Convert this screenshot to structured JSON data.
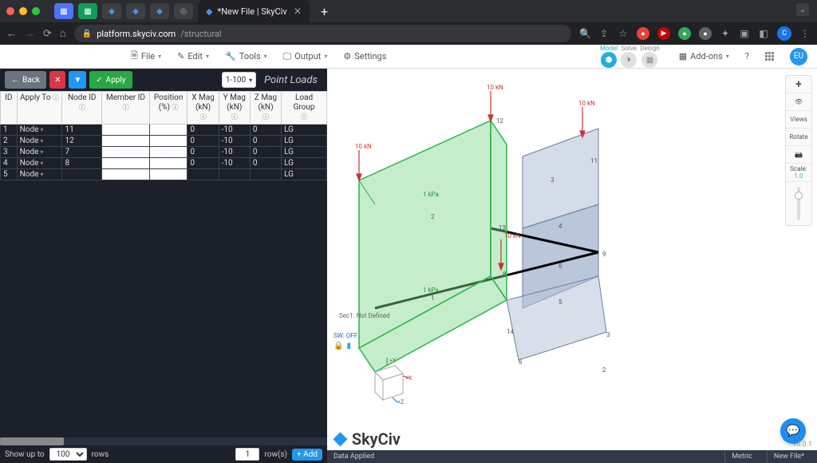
{
  "browser": {
    "tab_title": "*New File | SkyCiv",
    "url_domain": "platform.skyciv.com",
    "url_path": "/structural",
    "avatar": "C"
  },
  "toolbar": {
    "file": "File",
    "edit": "Edit",
    "tools": "Tools",
    "output": "Output",
    "settings": "Settings",
    "addons": "Add-ons",
    "wf_model": "Model",
    "wf_solve": "Solve",
    "wf_design": "Design",
    "eu": "EU"
  },
  "panel": {
    "back": "Back",
    "apply": "Apply",
    "range": "1-100",
    "title": "Point Loads",
    "headers": {
      "id": "ID",
      "apply": "Apply To",
      "node": "Node ID",
      "member": "Member ID",
      "pos": "Position (%)",
      "xmag": "X Mag (kN)",
      "ymag": "Y Mag (kN)",
      "zmag": "Z Mag (kN)",
      "lg": "Load Group"
    },
    "rows": [
      {
        "id": "1",
        "apply": "Node",
        "node": "11",
        "member": "",
        "pos": "",
        "x": "0",
        "y": "-10",
        "z": "0",
        "lg": "LG"
      },
      {
        "id": "2",
        "apply": "Node",
        "node": "12",
        "member": "",
        "pos": "",
        "x": "0",
        "y": "-10",
        "z": "0",
        "lg": "LG"
      },
      {
        "id": "3",
        "apply": "Node",
        "node": "7",
        "member": "",
        "pos": "",
        "x": "0",
        "y": "-10",
        "z": "0",
        "lg": "LG"
      },
      {
        "id": "4",
        "apply": "Node",
        "node": "8",
        "member": "",
        "pos": "",
        "x": "0",
        "y": "-10",
        "z": "0",
        "lg": "LG"
      },
      {
        "id": "5",
        "apply": "Node",
        "node": "",
        "member": "",
        "pos": "",
        "x": "",
        "y": "",
        "z": "",
        "lg": "LG"
      }
    ],
    "showup_label": "Show up to",
    "showup_val": "100",
    "rows_label": "rows",
    "rowcount": "1",
    "rowcount_suffix": "row(s)",
    "add": "+ Add"
  },
  "viewport": {
    "loads_kn": "10 kN",
    "area_load": "1 kPa",
    "sec_label": "Sec1: Not Defined",
    "sw": "SW: OFF",
    "axis_x": "+X",
    "axis_y": "+Y",
    "axis_z": "+Z",
    "logo": "SkyCiv",
    "version": "v6.0.1",
    "scale_label": "Scale:",
    "scale_val": "1.0",
    "views": "Views",
    "rotate": "Rotate"
  },
  "status": {
    "msg": "Data Applied",
    "units": "Metric",
    "file": "New File*"
  }
}
